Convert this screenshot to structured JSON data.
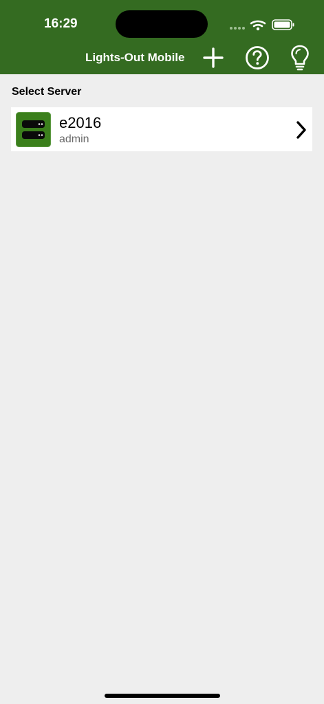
{
  "status_bar": {
    "time": "16:29",
    "icons": [
      "signal-dots-icon",
      "wifi-icon",
      "battery-icon"
    ]
  },
  "nav": {
    "title": "Lights-Out Mobile",
    "actions": [
      {
        "icon": "plus-icon"
      },
      {
        "icon": "question-circle-icon"
      },
      {
        "icon": "lightbulb-icon"
      }
    ]
  },
  "section": {
    "header": "Select Server"
  },
  "servers": [
    {
      "name": "e2016",
      "user": "admin",
      "icon": "server-icon"
    }
  ],
  "colors": {
    "header_bg": "#346b21",
    "page_bg": "#eeeeee",
    "server_icon_bg": "#3b7f1c"
  }
}
